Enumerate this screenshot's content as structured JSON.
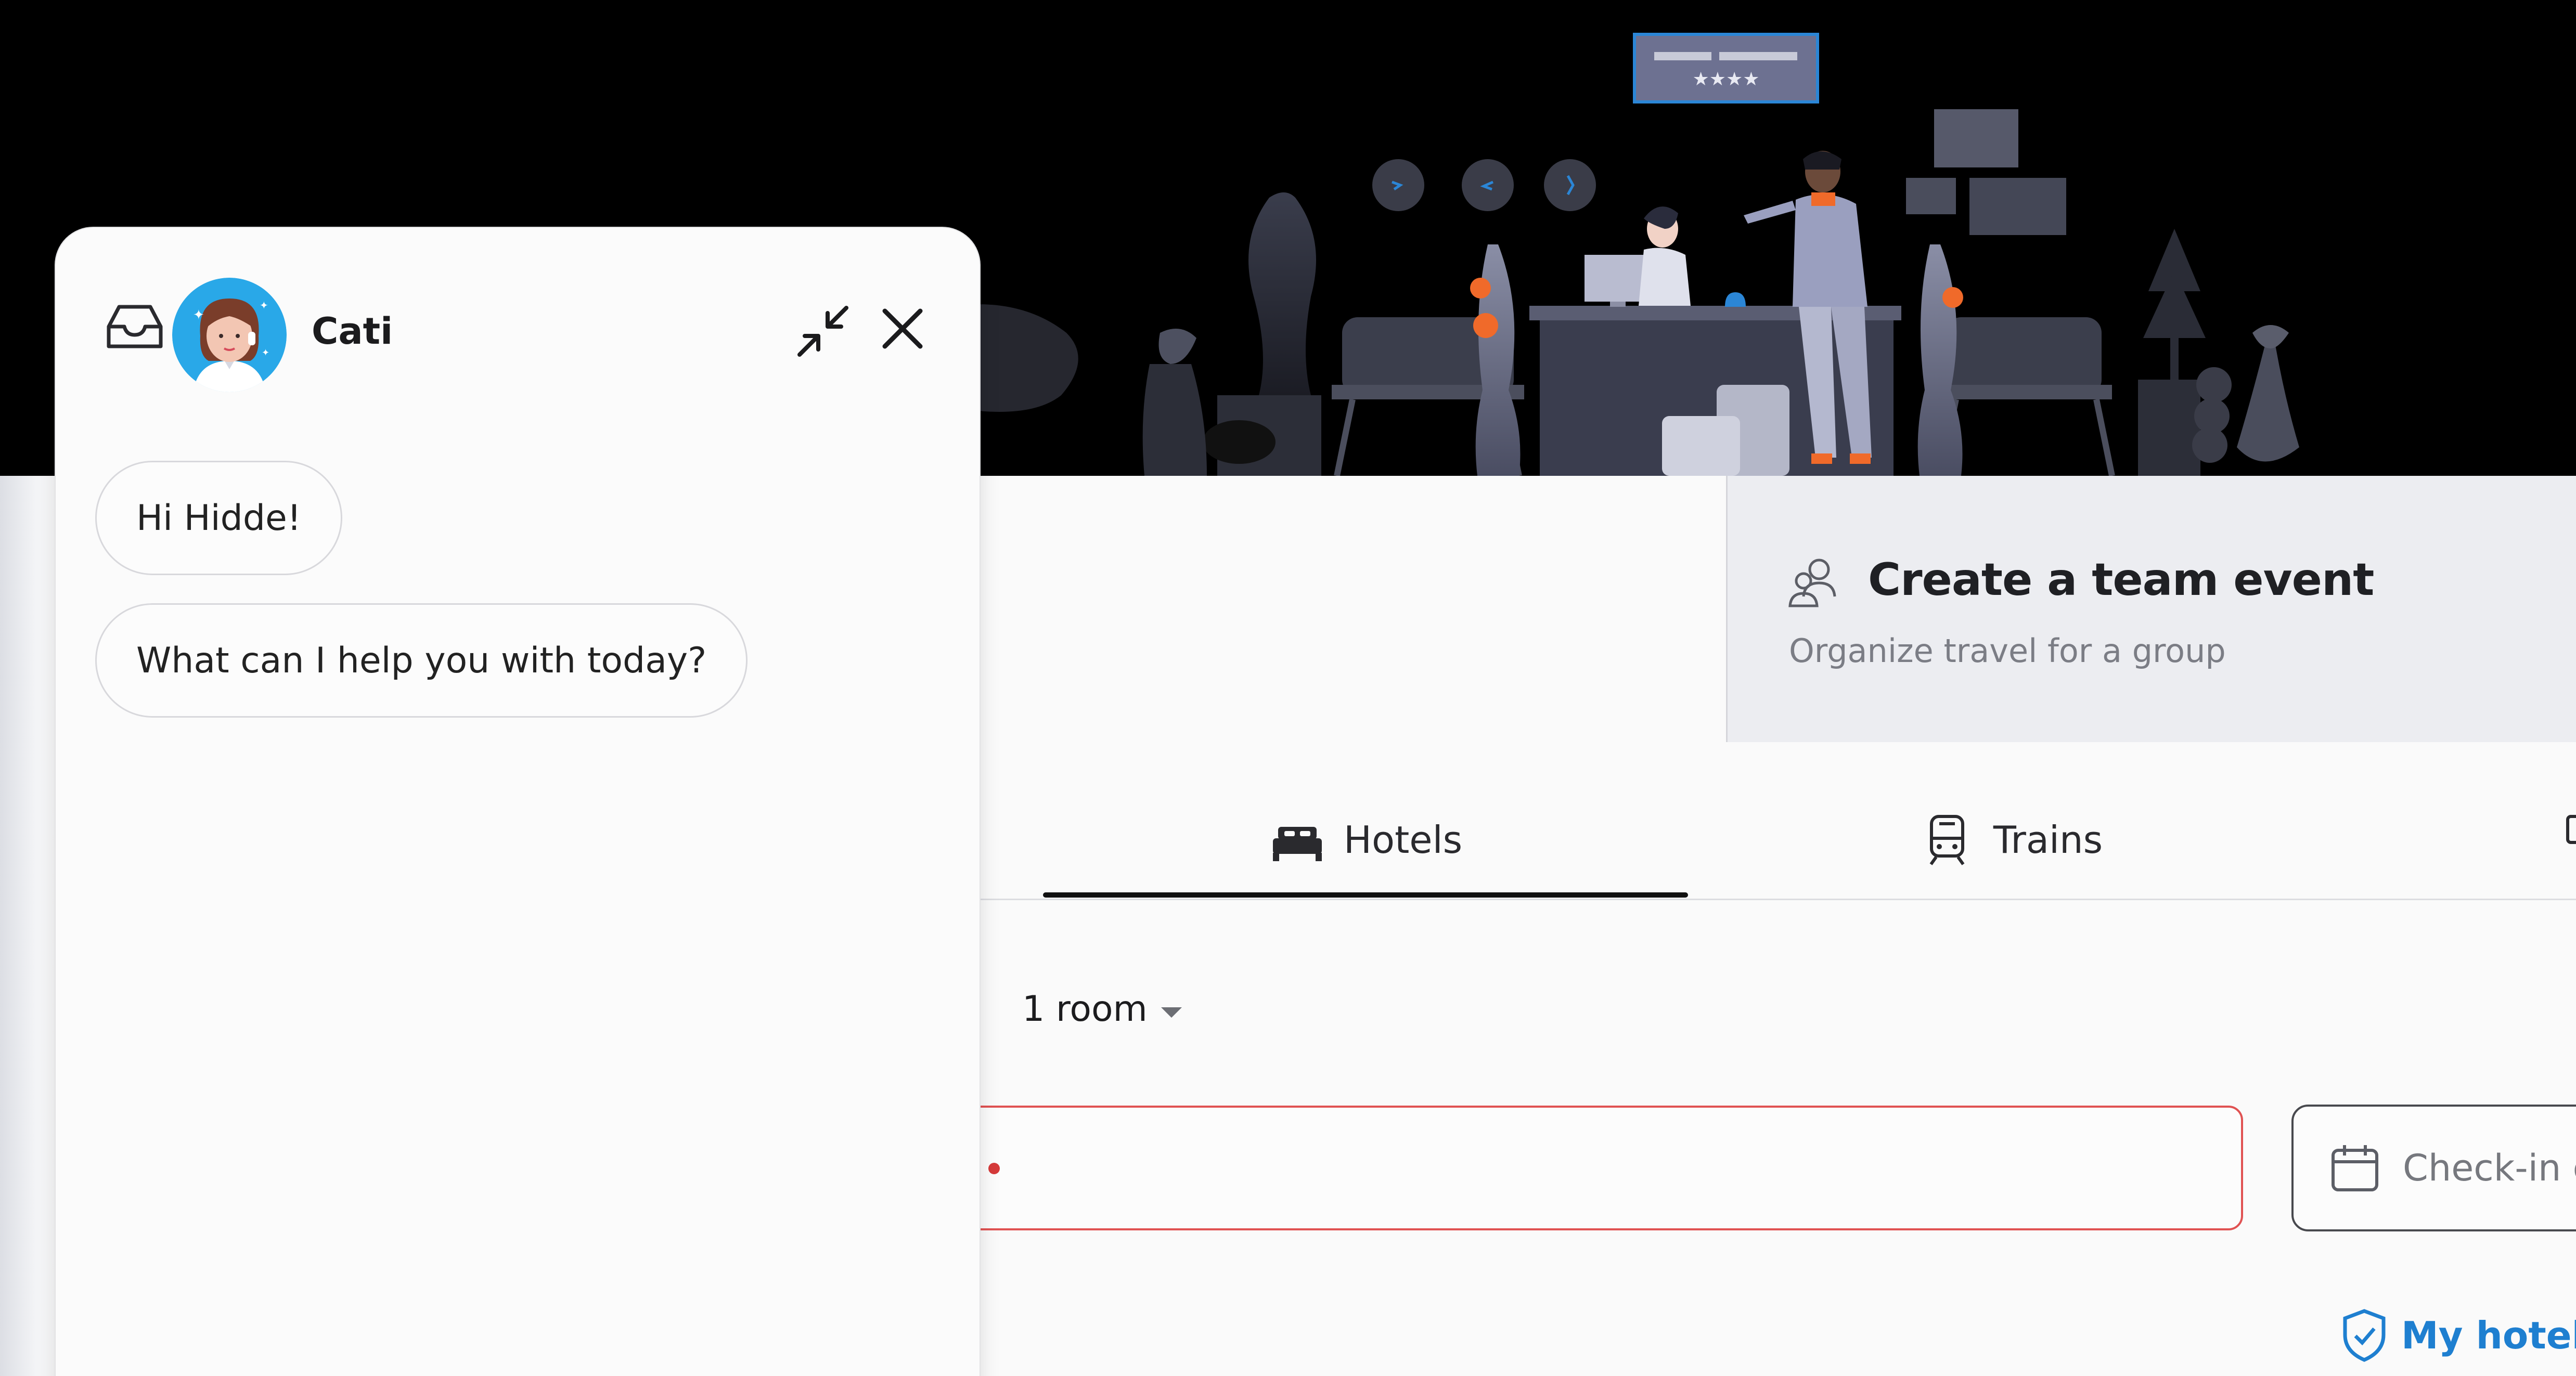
{
  "chat": {
    "agent_name": "Cati",
    "messages": [
      {
        "text": "Hi Hidde!"
      },
      {
        "text": "What can I help you with today?"
      }
    ]
  },
  "team_event": {
    "title": "Create a team event",
    "subtitle": "Organize travel for a group"
  },
  "tabs": [
    {
      "label": "Hotels",
      "icon": "bed-icon",
      "active": true
    },
    {
      "label": "Trains",
      "icon": "train-icon",
      "active": false
    }
  ],
  "search": {
    "rooms_label": "1 room",
    "checkin_placeholder": "Check-in c",
    "my_hotel_label": "My hotel p"
  },
  "colors": {
    "accent_blue": "#1e7fd0",
    "error_red": "#e05252",
    "hero_bg": "#000000",
    "avatar_bg": "#29a8e8",
    "illustration_orange": "#f06a2a"
  }
}
